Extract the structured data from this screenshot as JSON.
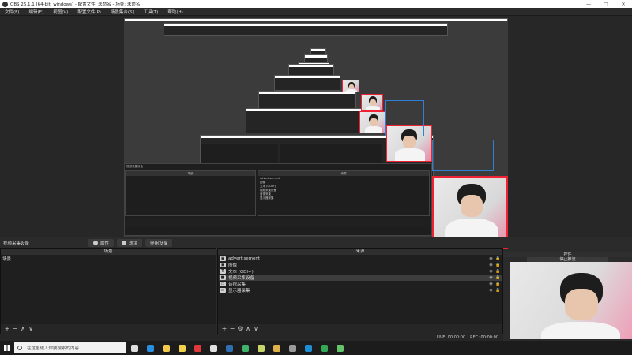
{
  "window": {
    "title": "OBS 26.1.1 (64-bit, windows) - 配置文件: 未命名 - 场景: 未命名",
    "minimize": "—",
    "maximize": "▢",
    "close": "✕"
  },
  "menu": [
    "文件(F)",
    "编辑(E)",
    "视图(V)",
    "配置文件(P)",
    "场景集合(S)",
    "工具(T)",
    "帮助(H)"
  ],
  "sourcebar": {
    "current_source": "视频采集设备",
    "properties": "属性",
    "filters": "滤镜",
    "deactivate": "停用设备"
  },
  "scenes": {
    "title": "场景",
    "items": [
      "场景"
    ]
  },
  "sources": {
    "title": "来源",
    "items": [
      {
        "icon": "image-icon",
        "glyph": "▣",
        "name": "advertisement",
        "selected": false
      },
      {
        "icon": "image-icon",
        "glyph": "▣",
        "name": "图像",
        "selected": false
      },
      {
        "icon": "text-icon",
        "glyph": "T",
        "name": "文本 (GDI+)",
        "selected": false
      },
      {
        "icon": "camera-icon",
        "glyph": "■",
        "name": "视频采集设备",
        "selected": true
      },
      {
        "icon": "monitor-icon",
        "glyph": "▭",
        "name": "音视采集",
        "selected": false
      },
      {
        "icon": "monitor-icon",
        "glyph": "▭",
        "name": "显示器采集",
        "selected": false
      }
    ]
  },
  "camdock": {
    "title": "控件",
    "subtitle": "停止推流"
  },
  "status": {
    "live": "LIVE: 00:00:00",
    "rec": "REC: 00:00:00"
  },
  "mini": {
    "scenes_header": "场景",
    "sources_header": "来源",
    "source_rows": [
      "advertisement",
      "图像",
      "文本 (GDI+)",
      "视频采集设备",
      "音视采集",
      "显示器采集"
    ],
    "source_label": "视频采集设备",
    "props": "属性",
    "filters": "滤镜",
    "deactivate": "停用设备"
  },
  "taskbar": {
    "search_placeholder": "在这里输入你要搜索的内容",
    "icons": [
      {
        "name": "task-view-icon",
        "color": "#dddddd"
      },
      {
        "name": "edge-icon",
        "color": "#2b8fe0"
      },
      {
        "name": "file-explorer-icon",
        "color": "#f2c94c"
      },
      {
        "name": "circle-app-icon",
        "color": "#f2d24c"
      },
      {
        "name": "red-app-icon",
        "color": "#e23a3a"
      },
      {
        "name": "store-icon",
        "color": "#e0e0e0"
      },
      {
        "name": "steam-icon",
        "color": "#2f6fb0"
      },
      {
        "name": "green-app-icon",
        "color": "#3fb36b"
      },
      {
        "name": "notes-app-icon",
        "color": "#c8d46a"
      },
      {
        "name": "folder-app-icon",
        "color": "#e0b048"
      },
      {
        "name": "obs-icon",
        "color": "#9a9a9a"
      },
      {
        "name": "edge-blue-icon",
        "color": "#1d8fd6"
      },
      {
        "name": "chrome-icon",
        "color": "#34a853"
      },
      {
        "name": "music-app-icon",
        "color": "#63c46a"
      }
    ]
  }
}
